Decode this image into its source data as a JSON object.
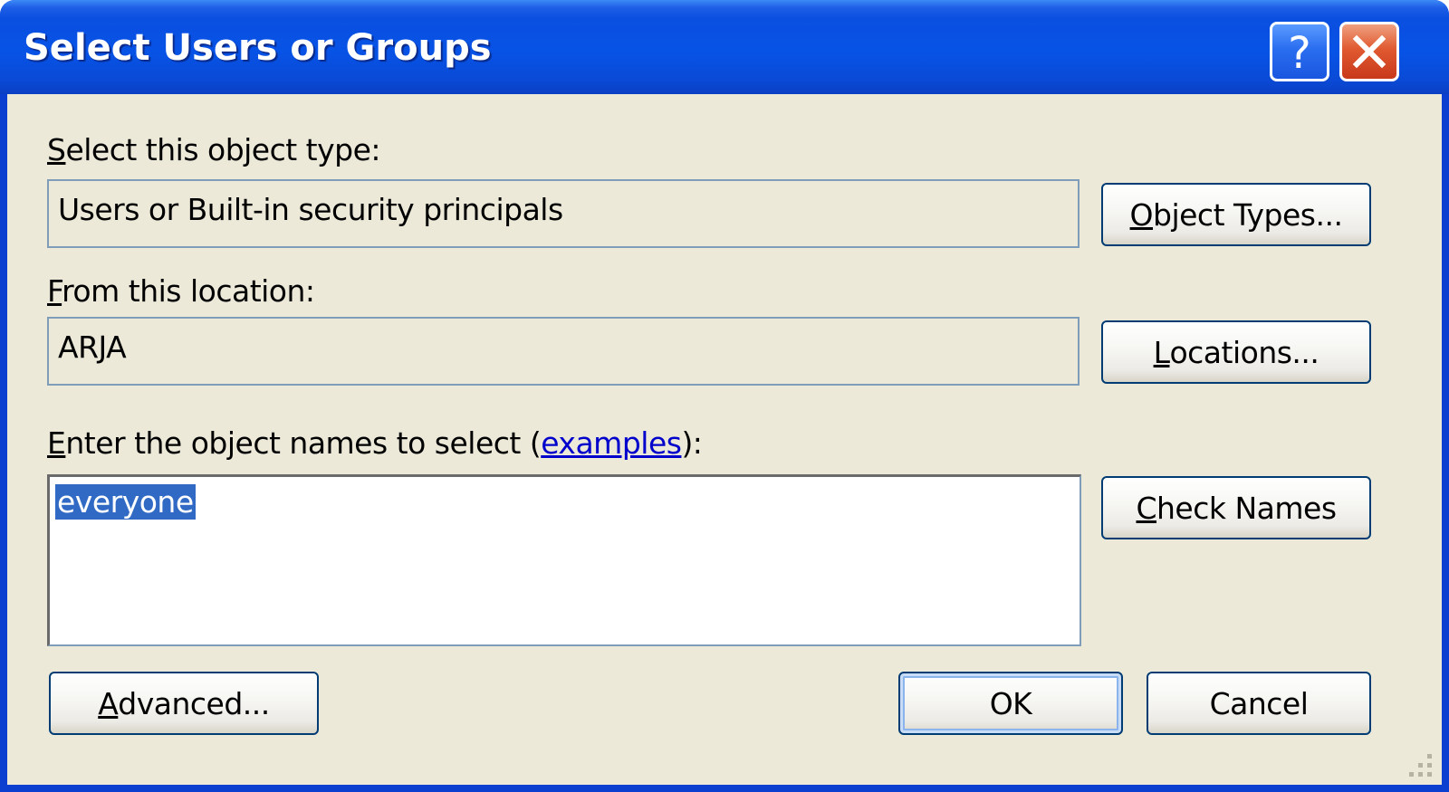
{
  "window": {
    "title": "Select Users or Groups",
    "help_icon": "question-mark-icon",
    "close_icon": "close-x-icon"
  },
  "object_type": {
    "label_accel": "S",
    "label_rest": "elect this object type:",
    "value": "Users or Built-in security principals",
    "button_accel": "O",
    "button_rest": "bject Types..."
  },
  "location": {
    "label_accel": "F",
    "label_rest": "rom this location:",
    "value": "ARJA",
    "button_accel": "L",
    "button_rest": "ocations..."
  },
  "names": {
    "label_accel": "E",
    "label_rest_before_link": "nter the object names to select (",
    "link_text": "examples",
    "label_after_link": "):",
    "value": "everyone",
    "button_accel": "C",
    "button_rest": "heck Names"
  },
  "footer": {
    "advanced_accel": "A",
    "advanced_rest": "dvanced...",
    "ok_label": "OK",
    "cancel_label": "Cancel"
  },
  "colors": {
    "titlebar": "#0753e6",
    "client_background": "#ece9d8",
    "selection_highlight": "#316ac5",
    "link": "#0000cc",
    "button_border": "#003c74",
    "close_button": "#e05a30"
  }
}
